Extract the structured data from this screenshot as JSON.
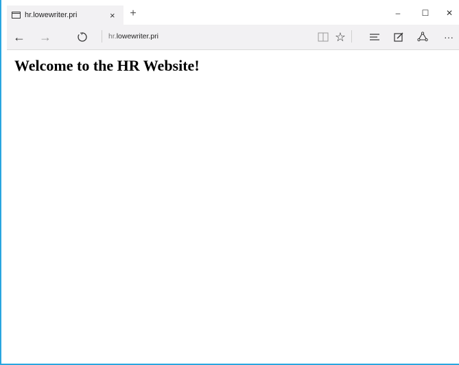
{
  "browser": {
    "tab": {
      "title": "hr.lowewriter.pri",
      "close_glyph": "×"
    },
    "new_tab_glyph": "+",
    "window_controls": {
      "minimize": "–",
      "maximize": "☐",
      "close": "✕"
    },
    "nav": {
      "back_glyph": "←",
      "forward_glyph": "→",
      "refresh_glyph": "↻"
    },
    "address": {
      "subdomain": "hr.",
      "domain": "lowewriter.pri"
    },
    "toolbar_icons": [
      "reading-view-icon",
      "favorite-star-icon",
      "hub-icon",
      "web-note-icon",
      "share-icon",
      "more-icon"
    ],
    "toolbar_glyphs": {
      "reading_view": "▯",
      "favorite": "☆",
      "hub": "≡",
      "web_note": "✎",
      "share": "⟐",
      "more": "···"
    }
  },
  "page": {
    "heading": "Welcome to the HR Website!"
  },
  "colors": {
    "window_border": "#29a6e0",
    "tab_active": "#f2f1f3",
    "tabstrip": "#cfcfcf"
  }
}
